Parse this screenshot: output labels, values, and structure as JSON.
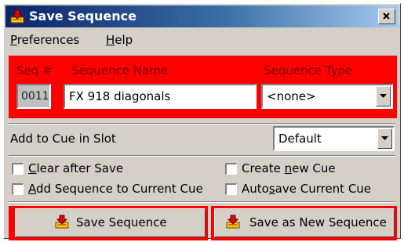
{
  "window": {
    "title": "Save Sequence",
    "close_glyph": "×",
    "accent_title_start": "#0a246a",
    "accent_title_end": "#a6caf0",
    "panel_color": "#ff0000"
  },
  "menu": {
    "items": [
      {
        "mnemonic": "P",
        "rest": "references"
      },
      {
        "mnemonic": "H",
        "rest": "elp"
      }
    ]
  },
  "header": {
    "seq_label": "Seq #",
    "name_label": "Sequence Name",
    "type_label": "Sequence Type"
  },
  "fields": {
    "seq_number": "0011",
    "sequence_name": "FX 918 diagonals",
    "sequence_type": "<none>"
  },
  "cue_slot": {
    "label": "Add to Cue in Slot",
    "value": "Default"
  },
  "options": {
    "clear_after_save": {
      "mnemonic": "C",
      "rest": "lear after Save",
      "checked": false
    },
    "add_to_current_cue": {
      "mnemonic": "A",
      "rest": "dd Sequence to Current Cue",
      "checked": false
    },
    "create_new_cue": {
      "before": "Create ",
      "mnemonic": "n",
      "rest": "ew Cue",
      "checked": false
    },
    "autosave_current_cue": {
      "before": "Auto",
      "mnemonic": "s",
      "rest": "ave Current Cue",
      "checked": false
    }
  },
  "buttons": {
    "save": "Save Sequence",
    "save_as_new": "Save as New Sequence"
  },
  "icons": {
    "title": "save-sequence-icon",
    "save_button": "save-sequence-icon",
    "save_as_button": "save-sequence-icon",
    "dropdown": "chevron-down-icon"
  }
}
